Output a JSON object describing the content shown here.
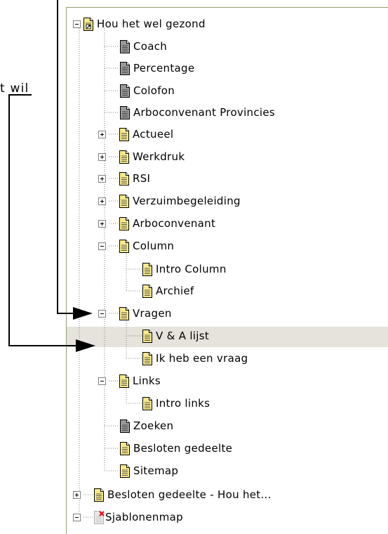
{
  "annotation": {
    "text": "t wil"
  },
  "tree": {
    "root": {
      "label": "Hou het wel gezond"
    },
    "children": [
      {
        "label": "Coach",
        "icon": "gray-document-icon"
      },
      {
        "label": "Percentage",
        "icon": "gray-document-icon"
      },
      {
        "label": "Colofon",
        "icon": "gray-document-icon"
      },
      {
        "label": "Arboconvenant Provincies",
        "icon": "gray-document-icon"
      },
      {
        "label": "Actueel",
        "icon": "yellow-document-icon"
      },
      {
        "label": "Werkdruk",
        "icon": "yellow-document-icon"
      },
      {
        "label": "RSI",
        "icon": "yellow-document-icon"
      },
      {
        "label": "Verzuimbegeleiding",
        "icon": "yellow-document-icon"
      },
      {
        "label": "Arboconvenant",
        "icon": "yellow-document-icon"
      },
      {
        "label": "Column",
        "icon": "yellow-document-icon",
        "children": [
          {
            "label": "Intro Column"
          },
          {
            "label": "Archief"
          }
        ]
      },
      {
        "label": "Vragen",
        "icon": "yellow-document-icon",
        "children": [
          {
            "label": "V & A lijst"
          },
          {
            "label": "Ik heb een vraag"
          }
        ]
      },
      {
        "label": "Links",
        "icon": "yellow-document-icon",
        "children": [
          {
            "label": "Intro links"
          }
        ]
      },
      {
        "label": "Zoeken",
        "icon": "gray-document-icon"
      },
      {
        "label": "Besloten gedeelte",
        "icon": "yellow-document-icon"
      },
      {
        "label": "Sitemap",
        "icon": "yellow-document-icon"
      }
    ],
    "siblings": [
      {
        "label": "Besloten gedeelte - Hou het..."
      },
      {
        "label": "Sjablonenmap"
      }
    ]
  },
  "colors": {
    "panel_border": "#8c9e6e",
    "selected_row": "#e6e3dd",
    "yellow_doc": "#f7e98a",
    "gray_doc": "#9a9a9a",
    "red_x": "#e01010"
  }
}
